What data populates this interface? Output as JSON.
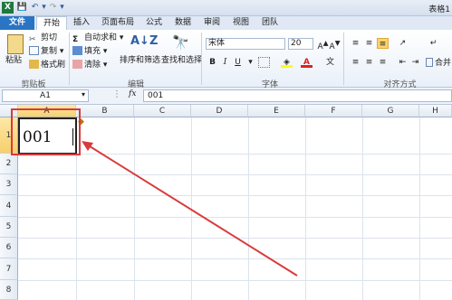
{
  "titlebar": {
    "title": "表格1",
    "file_icon": "excel-icon"
  },
  "tabs": [
    "文件",
    "开始",
    "插入",
    "页面布局",
    "公式",
    "数据",
    "审阅",
    "视图",
    "团队"
  ],
  "clipboard": {
    "paste": "粘贴",
    "cut": "剪切",
    "copy": "复制",
    "format_painter": "格式刷",
    "group": "剪贴板"
  },
  "editing": {
    "autosum": "自动求和",
    "fill": "填充",
    "clear": "清除",
    "sort_filter": "排序和筛选",
    "find_select": "查找和选择",
    "group": "编辑"
  },
  "font": {
    "name": "宋体",
    "size": "20",
    "bold": "B",
    "italic": "I",
    "underline": "U",
    "group": "字体"
  },
  "alignment": {
    "group": "对齐方式",
    "merge": "合并"
  },
  "formula_bar": {
    "name_box": "A1",
    "fx": "fx",
    "value": "001"
  },
  "columns": [
    "A",
    "B",
    "C",
    "D",
    "E",
    "F",
    "G",
    "H"
  ],
  "rows": [
    "1",
    "2",
    "3",
    "4",
    "5",
    "6",
    "7",
    "8"
  ],
  "cells": {
    "A1": "001"
  },
  "colors": {
    "accent": "#2a74c4",
    "highlight": "#d93a3a",
    "font_color": "#e02020",
    "fill_color": "#ffff00"
  }
}
